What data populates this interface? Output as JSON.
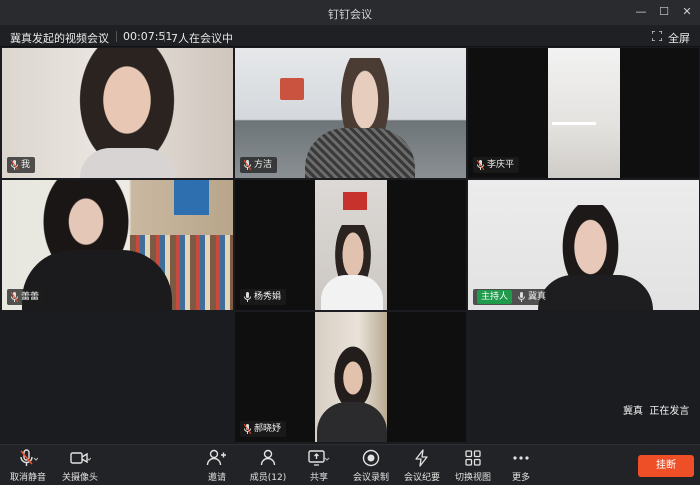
{
  "window": {
    "title": "钉钉会议"
  },
  "infobar": {
    "meeting_title": "冀真发起的视频会议",
    "timer": "00:07:51",
    "participant_count": "7人在会议中",
    "fullscreen_label": "全屏"
  },
  "tiles": [
    {
      "name": "我"
    },
    {
      "name": "方洁"
    },
    {
      "name": "李庆平"
    },
    {
      "name": "蕾蕾"
    },
    {
      "name": "杨秀娟"
    },
    {
      "name": "冀真",
      "badge": "主持人"
    },
    {
      "name": "郝晓妤"
    }
  ],
  "speaking": {
    "name": "冀真",
    "status": "正在发言"
  },
  "toolbar": {
    "mute": "取消静音",
    "camera": "关摄像头",
    "invite": "邀请",
    "members": "成员(12)",
    "share": "共享",
    "record": "会议录制",
    "minutes": "会议纪要",
    "switch_view": "切换视图",
    "more": "更多",
    "hangup": "挂断"
  },
  "colors": {
    "accent": "#29b35a",
    "hangup": "#ef4f26"
  }
}
